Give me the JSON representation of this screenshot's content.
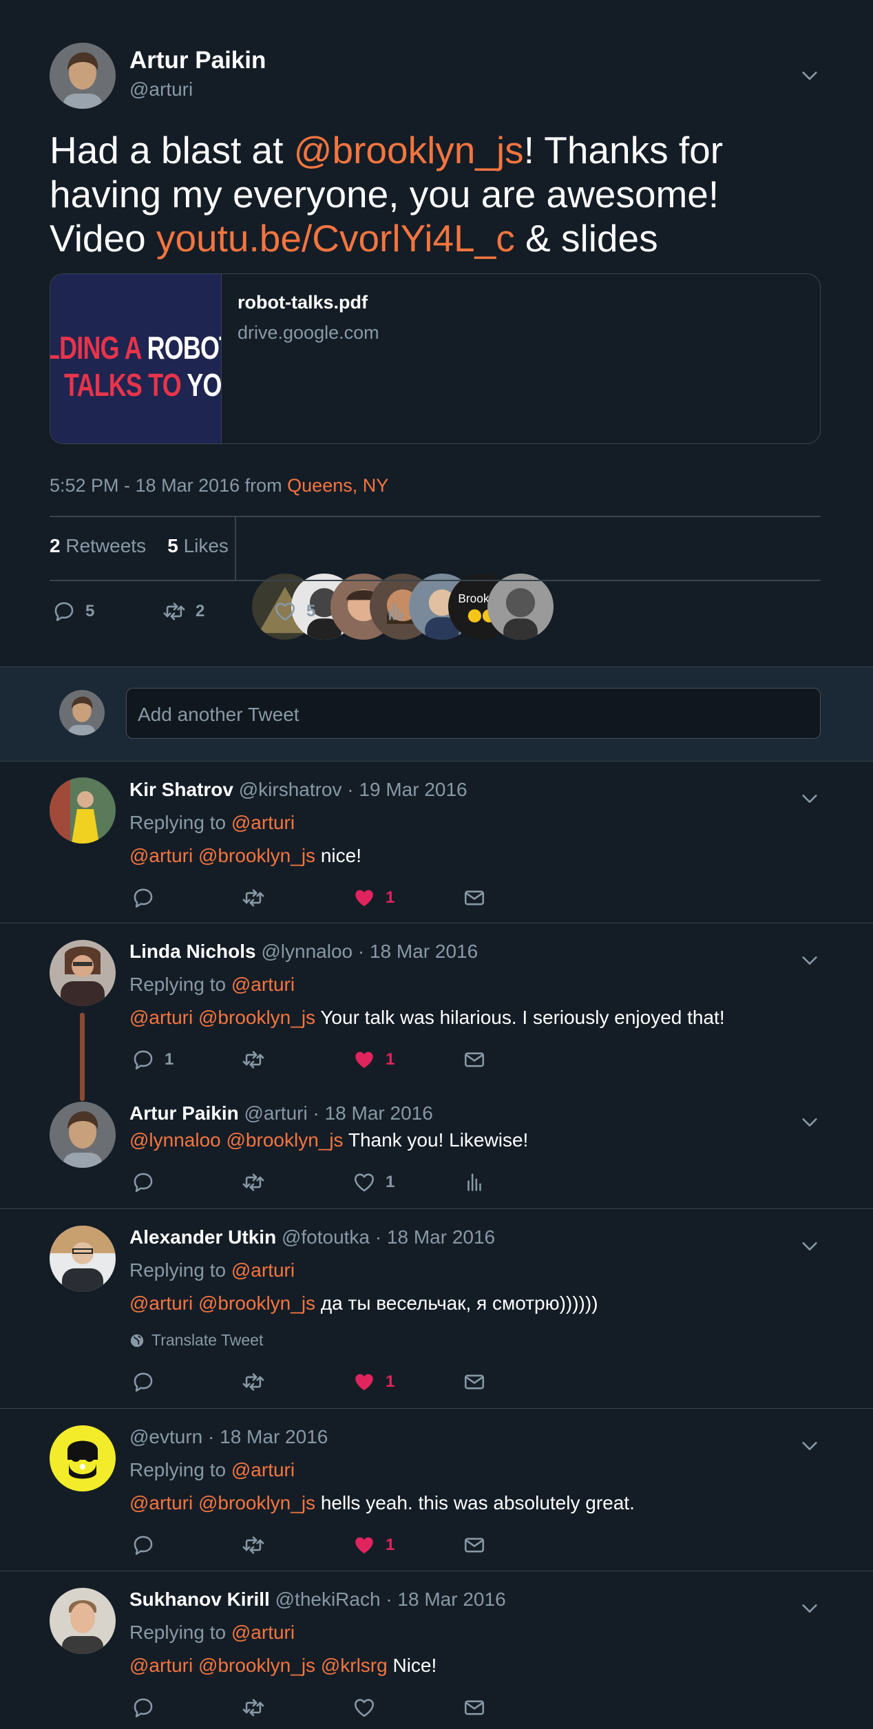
{
  "main_tweet": {
    "name": "Artur Paikin",
    "handle": "@arturi",
    "text_parts": {
      "p1": "Had a blast at ",
      "mention": "@brooklyn_js",
      "p2": "! Thanks for having my everyone, you are awesome! Video ",
      "link": "youtu.be/CvorlYi4L_c",
      "p3": " & slides"
    },
    "card": {
      "thumb_line1_white": "LDING A ",
      "thumb_line1_white2": "ROBOT T",
      "thumb_line2_red": "TALKS TO ",
      "thumb_line2_white": "YOU",
      "title": "robot-talks.pdf",
      "domain": "drive.google.com"
    },
    "meta_time": "5:52 PM - 18 Mar 2016 from ",
    "meta_place": "Queens, NY",
    "retweets_count": "2",
    "retweets_label": "Retweets",
    "likes_count": "5",
    "likes_label": "Likes",
    "actions": {
      "replies": "5",
      "retweets": "2",
      "likes": "5"
    }
  },
  "compose": {
    "placeholder": "Add another Tweet"
  },
  "replies": [
    {
      "name": "Kir Shatrov",
      "handle": "@kirshatrov",
      "date": "· 19 Mar 2016",
      "replying_label": "Replying to ",
      "replying_to": "@arturi",
      "mentions": "@arturi @brooklyn_js",
      "text": " nice!",
      "reply_count": "",
      "like_count": "1"
    },
    {
      "name": "Linda Nichols",
      "handle": "@lynnaloo",
      "date": "· 18 Mar 2016",
      "replying_label": "Replying to ",
      "replying_to": "@arturi",
      "mentions": "@arturi @brooklyn_js",
      "text": " Your talk was hilarious. I seriously enjoyed that!",
      "reply_count": "1",
      "like_count": "1"
    },
    {
      "name": "Artur Paikin",
      "handle": "@arturi",
      "date": "· 18 Mar 2016",
      "mentions": "@lynnaloo @brooklyn_js",
      "text": " Thank you! Likewise!",
      "like_count": "1"
    },
    {
      "name": "Alexander Utkin",
      "handle": "@fotoutka",
      "date": "· 18 Mar 2016",
      "replying_label": "Replying to ",
      "replying_to": "@arturi",
      "mentions": "@arturi @brooklyn_js",
      "text": " да ты весельчак, я смотрю))))))",
      "translate": "Translate Tweet",
      "like_count": "1"
    },
    {
      "name": "",
      "handle": "@evturn",
      "date": "· 18 Mar 2016",
      "replying_label": "Replying to ",
      "replying_to": "@arturi",
      "mentions": "@arturi @brooklyn_js",
      "text": " hells yeah. this was absolutely great.",
      "like_count": "1"
    },
    {
      "name": "Sukhanov Kirill",
      "handle": "@thekiRach",
      "date": "· 18 Mar 2016",
      "replying_label": "Replying to ",
      "replying_to": "@arturi",
      "mentions": "@arturi @brooklyn_js @krlsrg",
      "text": " Nice!"
    }
  ],
  "colors": {
    "background": "#141d26",
    "accent": "#f5753f",
    "muted": "#8899a6",
    "like": "#e0245e",
    "border": "#38444d"
  },
  "icons": [
    "chevron-down-icon",
    "reply-icon",
    "retweet-icon",
    "heart-icon",
    "analytics-icon",
    "mail-icon",
    "globe-icon"
  ]
}
